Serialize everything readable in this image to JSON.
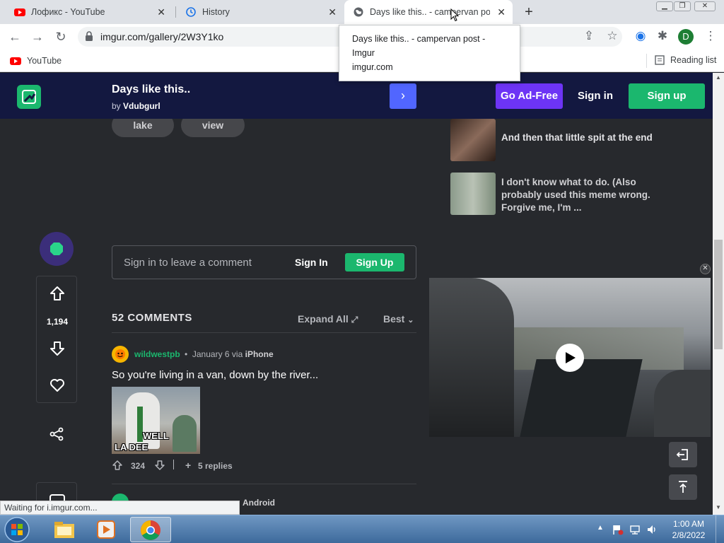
{
  "browser": {
    "tabs": [
      {
        "title": "Лофикс - YouTube",
        "icon": "youtube-icon",
        "active": false
      },
      {
        "title": "History",
        "icon": "history-icon",
        "active": false
      },
      {
        "title": "Days like this.. - campervan post",
        "icon": "globe-icon",
        "active": true
      }
    ],
    "url": "imgur.com/gallery/2W3Y1ko",
    "bookmarks": [
      {
        "label": "YouTube",
        "icon": "youtube-icon"
      }
    ],
    "reading_list": "Reading list",
    "profile_initial": "D",
    "tooltip": {
      "title": "Days like this.. - campervan post - Imgur",
      "domain": "imgur.com"
    },
    "status_text": "Waiting for i.imgur.com..."
  },
  "imgur": {
    "header": {
      "post_title": "Days like this..",
      "by_prefix": "by",
      "author": "Vdubgurl",
      "next_label": "›",
      "ad_free": "Go Ad-Free",
      "sign_in": "Sign in",
      "sign_up": "Sign up"
    },
    "tags": [
      "lake",
      "view"
    ],
    "related": [
      {
        "title": "And then that little spit at the end"
      },
      {
        "title": "I don't know what to do. (Also probably used this meme wrong. Forgive me, I'm ..."
      }
    ],
    "votes": {
      "count": "1,194"
    },
    "comment_box": {
      "placeholder": "Sign in to leave a comment",
      "sign_in": "Sign In",
      "sign_up": "Sign Up"
    },
    "comments_header": {
      "count_label": "52 COMMENTS",
      "expand_all": "Expand All",
      "sort": "Best"
    },
    "comments": [
      {
        "user": "wildwestpb",
        "date": "January 6",
        "via": "via",
        "platform": "iPhone",
        "text": "So you're living in a van, down by the river...",
        "image_caption_1": "WELL",
        "image_caption_2": "LA DEE",
        "upvotes": "324",
        "replies": "5 replies"
      },
      {
        "platform": "Android"
      }
    ]
  },
  "taskbar": {
    "time": "1:00 AM",
    "date": "2/8/2022"
  },
  "colors": {
    "imgur_header": "#131840",
    "imgur_green": "#1bb76e",
    "ad_free": "#6d34f5",
    "next_blue": "#5166ff",
    "page_bg": "#27292d"
  }
}
